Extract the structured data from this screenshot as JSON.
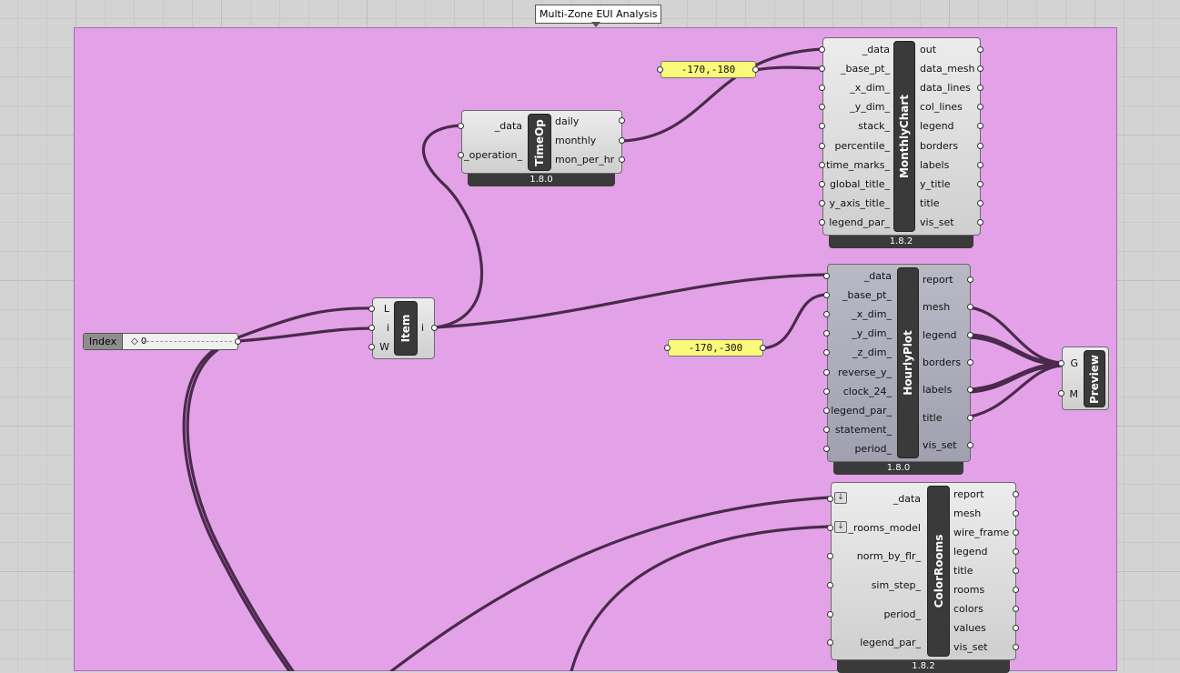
{
  "group": {
    "title": "Multi-Zone EUI Analysis",
    "color": "#e3a2e7"
  },
  "slider": {
    "label": "Index",
    "value": "0"
  },
  "panels": {
    "monthly_base_pt": "-170,-180",
    "hourly_base_pt": "-170,-300"
  },
  "item": {
    "name": "Item",
    "inputs": [
      "L",
      "i",
      "W"
    ],
    "outputs": [
      "i"
    ]
  },
  "timeop": {
    "name": "TimeOp",
    "version": "1.8.0",
    "inputs": [
      "_data",
      "_operation_"
    ],
    "outputs": [
      "daily",
      "monthly",
      "mon_per_hr"
    ]
  },
  "monthlychart": {
    "name": "MonthlyChart",
    "version": "1.8.2",
    "inputs": [
      "_data",
      "_base_pt_",
      "_x_dim_",
      "_y_dim_",
      "stack_",
      "percentile_",
      "time_marks_",
      "global_title_",
      "y_axis_title_",
      "legend_par_"
    ],
    "outputs": [
      "out",
      "data_mesh",
      "data_lines",
      "col_lines",
      "legend",
      "borders",
      "labels",
      "y_title",
      "title",
      "vis_set"
    ]
  },
  "hourlyplot": {
    "name": "HourlyPlot",
    "version": "1.8.0",
    "inputs": [
      "_data",
      "_base_pt_",
      "_x_dim_",
      "_y_dim_",
      "_z_dim_",
      "reverse_y_",
      "clock_24_",
      "legend_par_",
      "statement_",
      "period_"
    ],
    "outputs": [
      "report",
      "mesh",
      "legend",
      "borders",
      "labels",
      "title",
      "vis_set"
    ]
  },
  "colorrooms": {
    "name": "ColorRooms",
    "version": "1.8.2",
    "inputs": [
      "_data",
      "_rooms_model",
      "norm_by_flr_",
      "sim_step_",
      "period_",
      "legend_par_"
    ],
    "outputs": [
      "report",
      "mesh",
      "wire_frame",
      "legend",
      "title",
      "rooms",
      "colors",
      "values",
      "vis_set"
    ]
  },
  "preview": {
    "name": "Preview",
    "inputs": [
      "G",
      "M"
    ]
  }
}
